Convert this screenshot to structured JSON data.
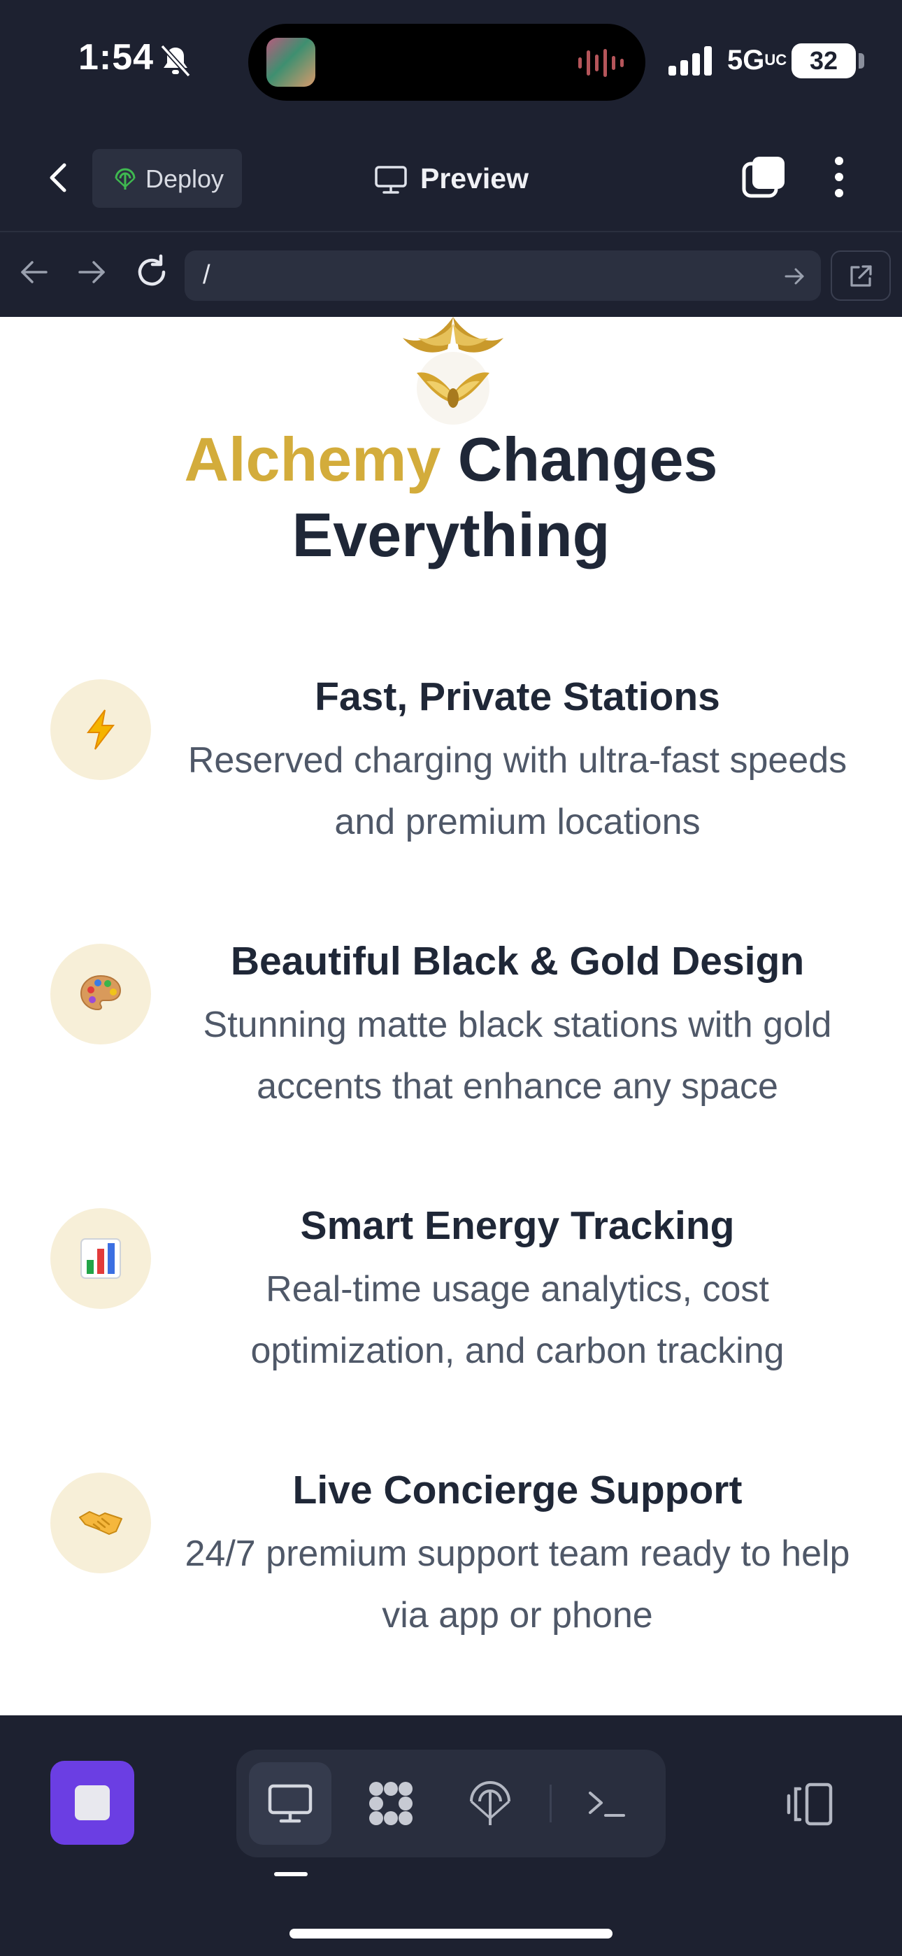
{
  "status_bar": {
    "time": "1:54",
    "network": "5G",
    "network_suffix": "UC",
    "battery": "32"
  },
  "header": {
    "deploy_label": "Deploy",
    "preview_label": "Preview"
  },
  "url_bar": {
    "url": "/"
  },
  "page": {
    "headline_accent": "Alchemy",
    "headline_rest_line1": " Changes",
    "headline_line2": "Everything",
    "features": [
      {
        "title": "Fast, Private Stations",
        "desc": "Reserved charging with ultra-fast speeds and premium locations",
        "icon": "lightning-icon"
      },
      {
        "title": "Beautiful Black & Gold Design",
        "desc": "Stunning matte black stations with gold accents that enhance any space",
        "icon": "palette-icon"
      },
      {
        "title": "Smart Energy Tracking",
        "desc": "Real-time usage analytics, cost optimization, and carbon tracking",
        "icon": "bar-chart-icon"
      },
      {
        "title": "Live Concierge Support",
        "desc": "24/7 premium support team ready to help via app or phone",
        "icon": "handshake-icon"
      }
    ]
  },
  "colors": {
    "accent_gold": "#d3ac3b",
    "stop_button": "#6b3ee3",
    "chrome_bg": "#1d2130"
  }
}
